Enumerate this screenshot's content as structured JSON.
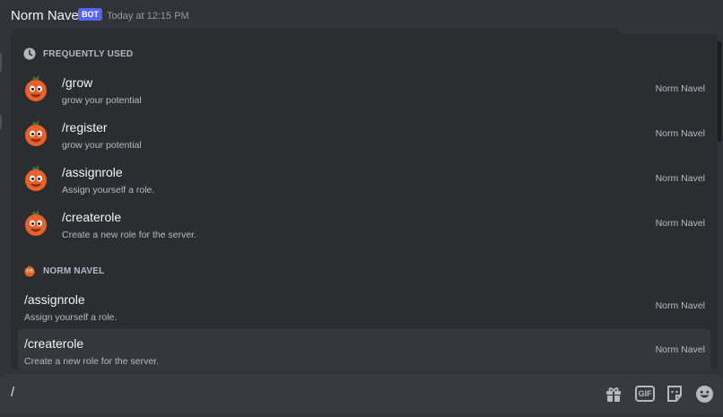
{
  "message": {
    "author": "Norm Navel",
    "bot_badge": "BOT",
    "timestamp": "Today at 12:15 PM"
  },
  "autocomplete": {
    "sections": [
      {
        "title": "FREQUENTLY USED",
        "icon": "clock-icon",
        "items": [
          {
            "name": "/grow",
            "description": "grow your potential",
            "source": "Norm Navel"
          },
          {
            "name": "/register",
            "description": "grow your potential",
            "source": "Norm Navel"
          },
          {
            "name": "/assignrole",
            "description": "Assign yourself a role.",
            "source": "Norm Navel"
          },
          {
            "name": "/createrole",
            "description": "Create a new role for the server.",
            "source": "Norm Navel"
          }
        ]
      },
      {
        "title": "NORM NAVEL",
        "icon": "norm-navel-avatar-icon",
        "items": [
          {
            "name": "/assignrole",
            "description": "Assign yourself a role.",
            "source": "Norm Navel"
          },
          {
            "name": "/createrole",
            "description": "Create a new role for the server.",
            "source": "Norm Navel",
            "selected": true
          }
        ]
      }
    ]
  },
  "input": {
    "value": "/"
  },
  "toolbar": {
    "gif_label": "GIF",
    "icons": [
      "gift-icon",
      "gif-icon",
      "sticker-icon",
      "emoji-icon"
    ]
  },
  "colors": {
    "background": "#313338",
    "popup": "#2b2d31",
    "selected_row": "#35373c",
    "input_bar": "#383a40",
    "bot_badge": "#5865f2",
    "avatar_orange": "#e8602a"
  }
}
